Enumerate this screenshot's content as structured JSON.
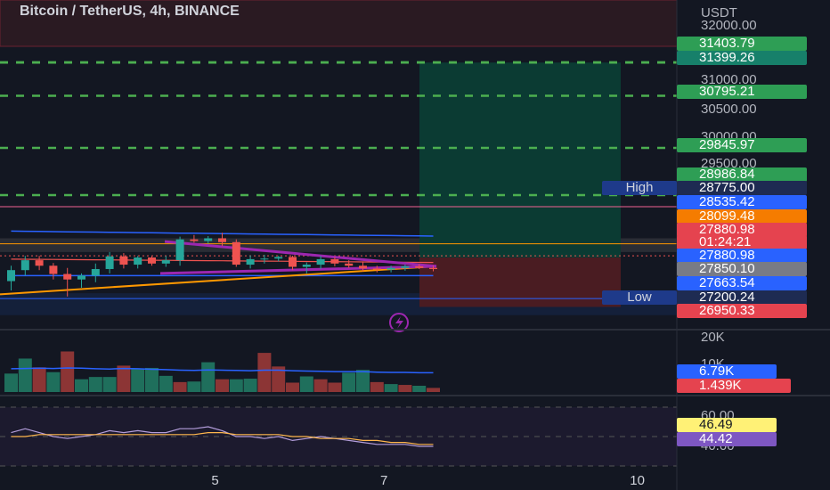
{
  "header": {
    "title": "Bitcoin / TetherUS, 4h, BINANCE"
  },
  "colors": {
    "background": "#131722",
    "up": "#26a69a",
    "down": "#ef5350",
    "level_line": "#4caf50",
    "trend": "#9c27b0",
    "ma_orange": "#ff9800",
    "ma_blue": "#2962ff",
    "profit_zone": "#0b3b33",
    "loss_zone": "#4a1c22"
  },
  "price_axis": {
    "unit": "USDT",
    "ticks": [
      "32000.00",
      "31000.00",
      "30500.00",
      "30000.00",
      "29500.00"
    ]
  },
  "price_tags": [
    {
      "value": "31403.79",
      "bg": "#2e9e55",
      "fg": "#ffffff"
    },
    {
      "value": "31399.26",
      "bg": "#17806a",
      "fg": "#ffffff"
    },
    {
      "value": "30795.21",
      "bg": "#2e9e55",
      "fg": "#ffffff"
    },
    {
      "value": "29845.97",
      "bg": "#2e9e55",
      "fg": "#ffffff"
    },
    {
      "value": "28986.84",
      "bg": "#2e9e55",
      "fg": "#ffffff"
    },
    {
      "value": "28775.00",
      "bg": "#1e2b52",
      "fg": "#ffffff"
    },
    {
      "value": "28535.42",
      "bg": "#2962ff",
      "fg": "#ffffff"
    },
    {
      "value": "28099.48",
      "bg": "#f57c00",
      "fg": "#ffffff"
    },
    {
      "value": "27880.98",
      "bg": "#e5434f",
      "fg": "#ffffff"
    },
    {
      "value": "01:24:21",
      "bg": "#e5434f",
      "fg": "#ffffff"
    },
    {
      "value": "27880.98",
      "bg": "#2962ff",
      "fg": "#ffffff"
    },
    {
      "value": "27850.10",
      "bg": "#787b86",
      "fg": "#ffffff"
    },
    {
      "value": "27663.54",
      "bg": "#2962ff",
      "fg": "#ffffff"
    },
    {
      "value": "27200.24",
      "bg": "#1e2b52",
      "fg": "#ffffff"
    },
    {
      "value": "26950.33",
      "bg": "#e5434f",
      "fg": "#ffffff"
    }
  ],
  "markers": {
    "high": "High",
    "low": "Low"
  },
  "volume_pane": {
    "ticks": [
      "20K",
      "10K"
    ],
    "tags": [
      {
        "value": "6.79K",
        "bg": "#2962ff"
      },
      {
        "value": "1.439K",
        "bg": "#e5434f"
      }
    ]
  },
  "rsi_pane": {
    "ticks": [
      "60.00",
      "40.00"
    ],
    "tags": [
      {
        "value": "46.49",
        "bg": "#fff176",
        "fg": "#131722"
      },
      {
        "value": "44.42",
        "bg": "#7e57c2",
        "fg": "#ffffff"
      }
    ]
  },
  "time_axis": {
    "ticks": [
      "5",
      "7",
      "10"
    ]
  },
  "chart_data": {
    "type": "candlestick",
    "title": "Bitcoin / TetherUS, 4h, BINANCE",
    "candles": [
      {
        "o": 27420,
        "h": 27700,
        "l": 27250,
        "c": 27620
      },
      {
        "o": 27620,
        "h": 27880,
        "l": 27520,
        "c": 27800
      },
      {
        "o": 27800,
        "h": 27880,
        "l": 27620,
        "c": 27700
      },
      {
        "o": 27700,
        "h": 27750,
        "l": 27450,
        "c": 27550
      },
      {
        "o": 27550,
        "h": 27660,
        "l": 27140,
        "c": 27450
      },
      {
        "o": 27450,
        "h": 27560,
        "l": 27300,
        "c": 27520
      },
      {
        "o": 27520,
        "h": 27740,
        "l": 27400,
        "c": 27640
      },
      {
        "o": 27640,
        "h": 27950,
        "l": 27560,
        "c": 27870
      },
      {
        "o": 27870,
        "h": 27930,
        "l": 27650,
        "c": 27720
      },
      {
        "o": 27720,
        "h": 27880,
        "l": 27650,
        "c": 27850
      },
      {
        "o": 27850,
        "h": 27870,
        "l": 27700,
        "c": 27740
      },
      {
        "o": 27740,
        "h": 27880,
        "l": 27680,
        "c": 27800
      },
      {
        "o": 27800,
        "h": 28230,
        "l": 27700,
        "c": 28180
      },
      {
        "o": 28180,
        "h": 28260,
        "l": 28120,
        "c": 28150
      },
      {
        "o": 28150,
        "h": 28240,
        "l": 28100,
        "c": 28200
      },
      {
        "o": 28200,
        "h": 28300,
        "l": 28060,
        "c": 28130
      },
      {
        "o": 28130,
        "h": 28180,
        "l": 27680,
        "c": 27720
      },
      {
        "o": 27720,
        "h": 27890,
        "l": 27650,
        "c": 27820
      },
      {
        "o": 27820,
        "h": 27900,
        "l": 27740,
        "c": 27830
      },
      {
        "o": 27830,
        "h": 27880,
        "l": 27780,
        "c": 27860
      },
      {
        "o": 27860,
        "h": 27880,
        "l": 27620,
        "c": 27680
      },
      {
        "o": 27680,
        "h": 27760,
        "l": 27560,
        "c": 27720
      },
      {
        "o": 27720,
        "h": 27880,
        "l": 27640,
        "c": 27820
      },
      {
        "o": 27820,
        "h": 27860,
        "l": 27690,
        "c": 27740
      },
      {
        "o": 27740,
        "h": 27800,
        "l": 27660,
        "c": 27700
      },
      {
        "o": 27700,
        "h": 27780,
        "l": 27600,
        "c": 27650
      },
      {
        "o": 27650,
        "h": 27700,
        "l": 27580,
        "c": 27630
      },
      {
        "o": 27630,
        "h": 27700,
        "l": 27580,
        "c": 27660
      },
      {
        "o": 27660,
        "h": 27720,
        "l": 27610,
        "c": 27690
      },
      {
        "o": 27690,
        "h": 27730,
        "l": 27640,
        "c": 27660
      },
      {
        "o": 27660,
        "h": 27700,
        "l": 27600,
        "c": 27640
      }
    ],
    "volume": [
      {
        "v": 6500,
        "up": true
      },
      {
        "v": 11800,
        "up": true
      },
      {
        "v": 8700,
        "up": false
      },
      {
        "v": 7000,
        "up": true
      },
      {
        "v": 14300,
        "up": false
      },
      {
        "v": 4500,
        "up": true
      },
      {
        "v": 5300,
        "up": true
      },
      {
        "v": 5300,
        "up": true
      },
      {
        "v": 9300,
        "up": false
      },
      {
        "v": 8300,
        "up": true
      },
      {
        "v": 8500,
        "up": true
      },
      {
        "v": 5700,
        "up": true
      },
      {
        "v": 3500,
        "up": false
      },
      {
        "v": 3700,
        "up": true
      },
      {
        "v": 10500,
        "up": true
      },
      {
        "v": 4500,
        "up": false
      },
      {
        "v": 4500,
        "up": true
      },
      {
        "v": 4700,
        "up": true
      },
      {
        "v": 13800,
        "up": false
      },
      {
        "v": 9000,
        "up": false
      },
      {
        "v": 3300,
        "up": false
      },
      {
        "v": 5500,
        "up": true
      },
      {
        "v": 4500,
        "up": false
      },
      {
        "v": 3300,
        "up": false
      },
      {
        "v": 6800,
        "up": true
      },
      {
        "v": 7800,
        "up": true
      },
      {
        "v": 3500,
        "up": false
      },
      {
        "v": 2800,
        "up": true
      },
      {
        "v": 2500,
        "up": false
      },
      {
        "v": 2200,
        "up": true
      },
      {
        "v": 1439,
        "up": false
      }
    ],
    "volume_ma": [
      8200,
      8300,
      8400,
      8300,
      8500,
      8400,
      8200,
      8100,
      8300,
      8200,
      8000,
      7900,
      7700,
      7600,
      7800,
      7700,
      7600,
      7500,
      7700,
      7700,
      7500,
      7400,
      7300,
      7200,
      7200,
      7200,
      7000,
      6900,
      6900,
      6800,
      6790
    ],
    "rsi": [
      52,
      54,
      52,
      50,
      49,
      50,
      51,
      53,
      52,
      53,
      52,
      52,
      54,
      54,
      55,
      53,
      50,
      50,
      49,
      50,
      48,
      49,
      50,
      49,
      48,
      47,
      46,
      46,
      46,
      45,
      45
    ],
    "rsi_ma": [
      50,
      50,
      51,
      51,
      51,
      51,
      51,
      51,
      51,
      51,
      51,
      51,
      51,
      51,
      52,
      52,
      51,
      51,
      51,
      51,
      50,
      50,
      49,
      49,
      49,
      48,
      48,
      47,
      47,
      46,
      46
    ],
    "x_ticks": [
      {
        "label": "5",
        "index": 14.5
      },
      {
        "label": "7",
        "index": 26.5
      },
      {
        "label": "10",
        "index": 44.5
      }
    ],
    "levels": [
      31403.79,
      31399.26,
      30795.21,
      29845.97,
      28986.84
    ],
    "high": 28775.0,
    "low": 27200.24,
    "position": {
      "entry": 27850.1,
      "target": 31399.26,
      "stop": 26950.33
    },
    "y_range": [
      26780,
      32100
    ],
    "volume_range": [
      0,
      22000
    ],
    "rsi_range": [
      30,
      70
    ]
  }
}
